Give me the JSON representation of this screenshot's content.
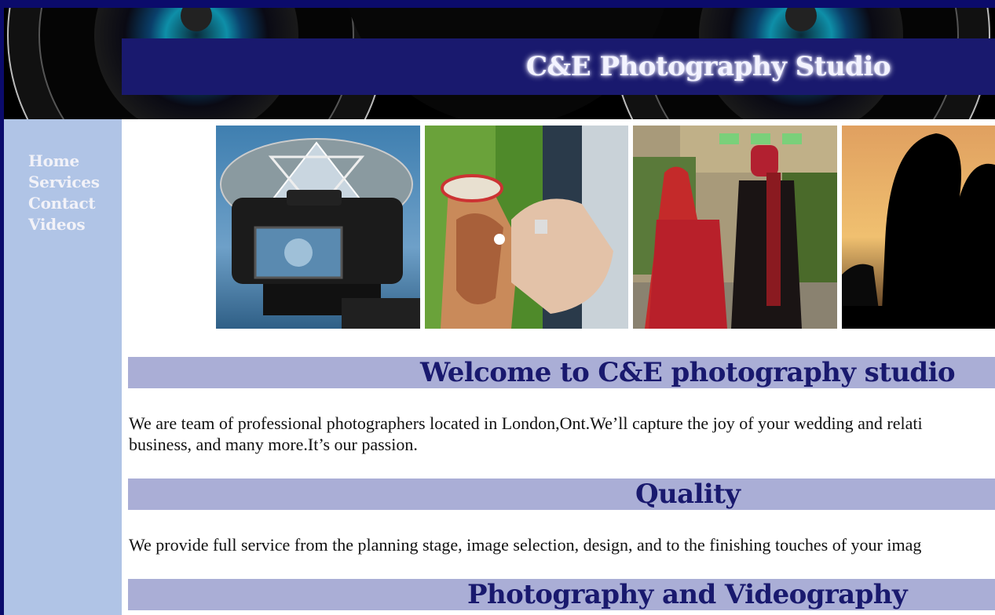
{
  "header": {
    "title": "C&E Photography Studio"
  },
  "nav": {
    "items": [
      "Home",
      "Services",
      "Contact",
      "Videos"
    ]
  },
  "gallery": {
    "photos": [
      "camera-photo",
      "hands-rings-photo",
      "bride-groom-photo",
      "silhouette-couple-photo"
    ]
  },
  "sections": {
    "welcome": {
      "heading": "Welcome to C&E photography studio",
      "line1": "We are team of professional photographers located in London,Ont.We’ll capture the joy of your wedding and relati",
      "line2": "business, and many more.It’s our passion."
    },
    "quality": {
      "heading": "Quality",
      "line1": "We provide full service from the planning stage, image selection, design, and to the finishing touches of your imag"
    },
    "photo_video": {
      "heading": "Photography and Videography"
    }
  },
  "colors": {
    "page_border": "#0b0b6b",
    "title_bar": "#19196e",
    "sidebar": "#b0c4e6",
    "heading_bg": "#aaaed6",
    "heading_text": "#19196e"
  }
}
